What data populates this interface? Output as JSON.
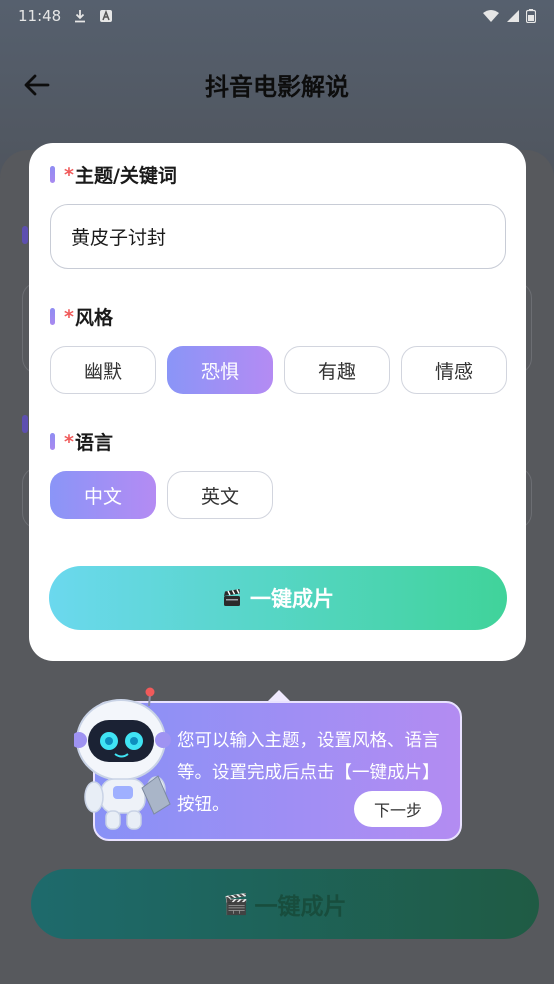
{
  "status_bar": {
    "time": "11:48"
  },
  "header": {
    "title": "抖音电影解说"
  },
  "dialog": {
    "topic": {
      "required_mark": "*",
      "label": "主题/关键词",
      "value": "黄皮子讨封"
    },
    "style": {
      "required_mark": "*",
      "label": "风格",
      "options": [
        "幽默",
        "恐惧",
        "有趣",
        "情感"
      ],
      "selected": "恐惧"
    },
    "language": {
      "required_mark": "*",
      "label": "语言",
      "options": [
        "中文",
        "英文"
      ],
      "selected": "中文"
    },
    "generate_button": "一键成片"
  },
  "tooltip": {
    "text": "您可以输入主题，设置风格、语言等。设置完成后点击【一键成片】按钮。",
    "next_button": "下一步"
  },
  "background": {
    "generate_button": "一键成片"
  },
  "colors": {
    "accent_purple": "#9a8ff4",
    "accent_green": "#40d39a",
    "accent_cyan": "#6bd8ee",
    "required": "#f05a5a"
  }
}
